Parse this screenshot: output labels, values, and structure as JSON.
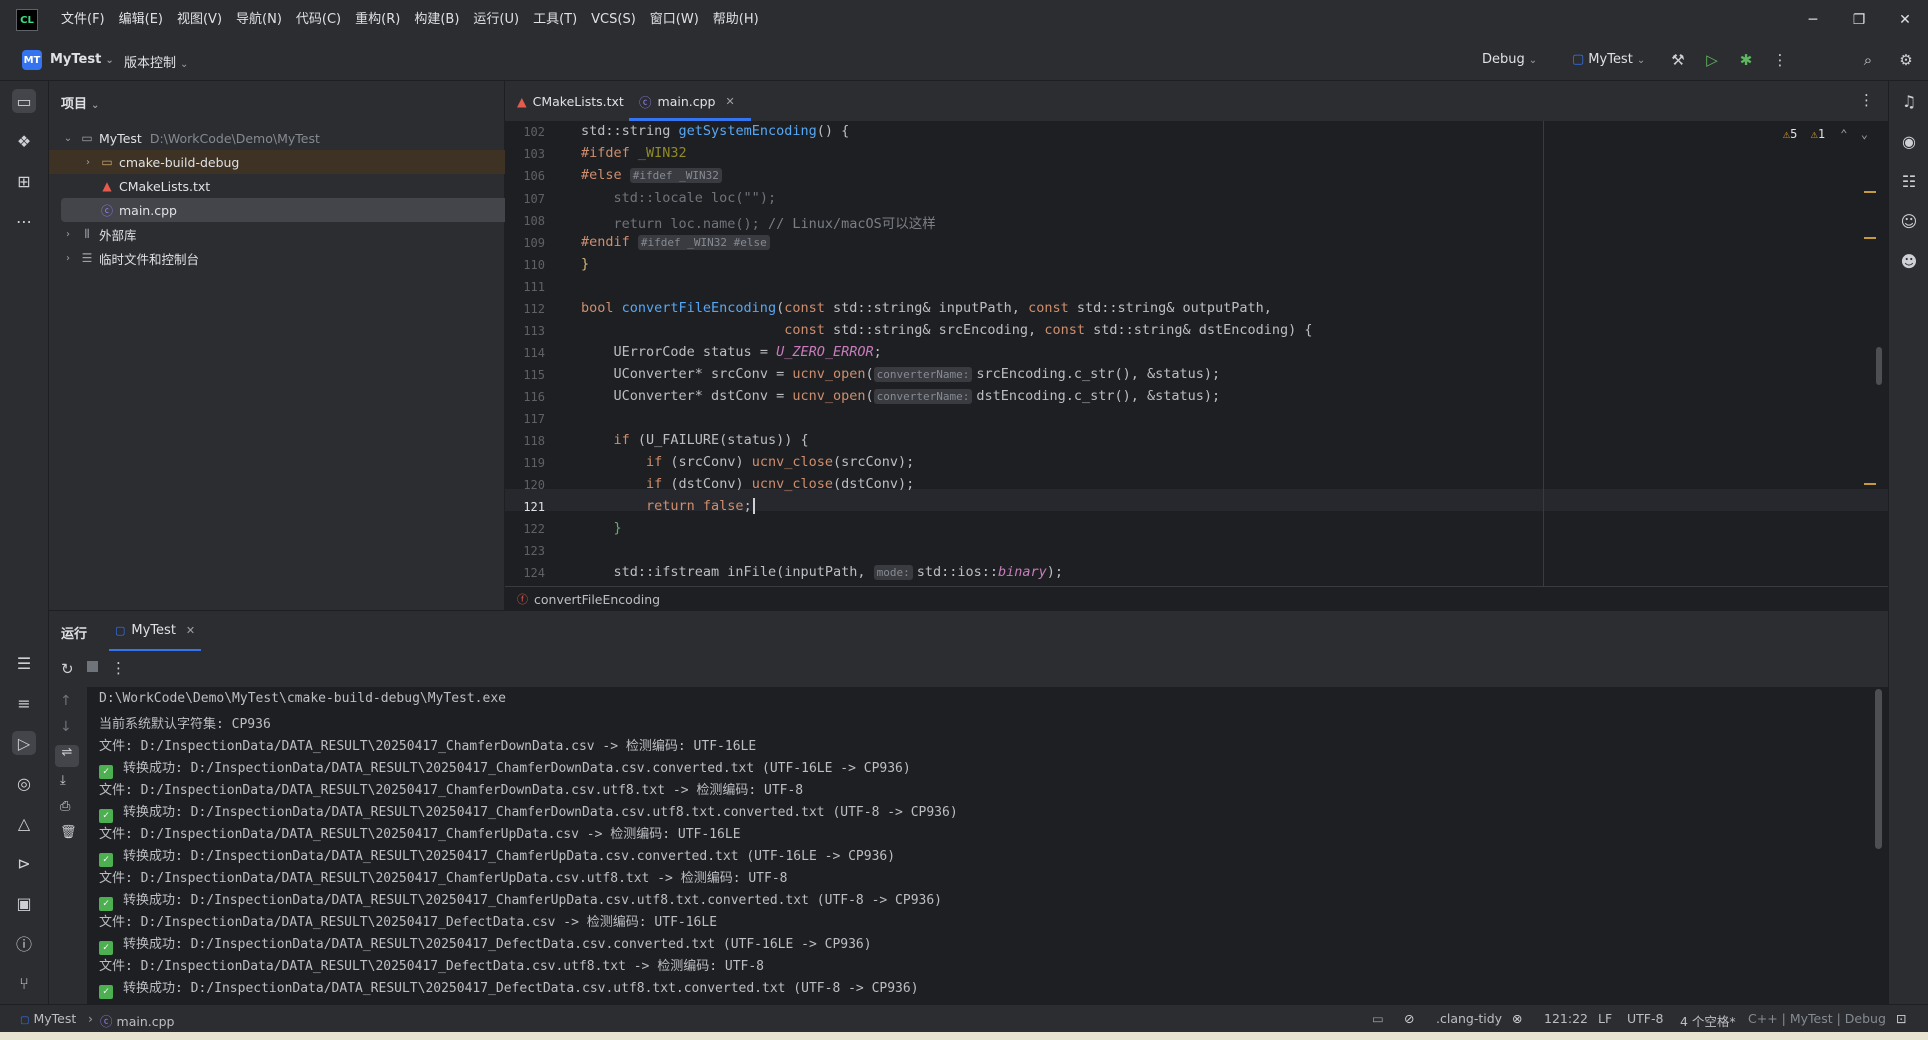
{
  "menubar": {
    "logo": "CL",
    "items": [
      "文件(F)",
      "编辑(E)",
      "视图(V)",
      "导航(N)",
      "代码(C)",
      "重构(R)",
      "构建(B)",
      "运行(U)",
      "工具(T)",
      "VCS(S)",
      "窗口(W)",
      "帮助(H)"
    ]
  },
  "toolbar": {
    "project_badge": "MT",
    "project_name": "MyTest",
    "vcs_label": "版本控制",
    "debug_config": "Debug",
    "run_target": "MyTest"
  },
  "project_panel": {
    "title": "项目",
    "tree": [
      {
        "label": "MyTest",
        "path": "D:\\WorkCode\\Demo\\MyTest"
      },
      {
        "label": "cmake-build-debug"
      },
      {
        "label": "CMakeLists.txt"
      },
      {
        "label": "main.cpp"
      },
      {
        "label": "外部库"
      },
      {
        "label": "临时文件和控制台"
      }
    ]
  },
  "editor": {
    "tabs": [
      {
        "label": "CMakeLists.txt"
      },
      {
        "label": "main.cpp"
      }
    ],
    "inspections": {
      "warnings": "5",
      "weak_warnings": "1"
    },
    "line_numbers": [
      "102",
      "103",
      "106",
      "107",
      "108",
      "109",
      "110",
      "111",
      "112",
      "113",
      "114",
      "115",
      "116",
      "117",
      "118",
      "119",
      "120",
      "121",
      "122",
      "123",
      "124"
    ],
    "code": {
      "l102_type": "std::string ",
      "l102_fn": "getSystemEncoding",
      "l102_rest": "() {",
      "l103_kw": "#ifdef",
      "l103_macro": "_WIN32",
      "l106_kw": "#else",
      "l106_hint": "#ifdef _WIN32",
      "l107": "std::locale loc(\"\");",
      "l108_a": "return loc.name(); ",
      "l108_cmt": "// Linux/macOS可以这样",
      "l109_kw": "#endif",
      "l109_hint": "#ifdef _WIN32 #else",
      "l110": "}",
      "l112_kw": "bool ",
      "l112_fn": "convertFileEncoding",
      "l112_a": "(",
      "l112_b": "const ",
      "l112_c": "std::string& inputPath, ",
      "l112_d": "const ",
      "l112_e": "std::string& outputPath,",
      "l113_a": "const ",
      "l113_b": "std::string& srcEncoding, ",
      "l113_c": "const ",
      "l113_d": "std::string& dstEncoding) {",
      "l114_a": "UErrorCode status = ",
      "l114_const": "U_ZERO_ERROR",
      "l114_b": ";",
      "l115_a": "UConverter* srcConv = ",
      "l115_fn": "ucnv_open",
      "l115_hint": "converterName:",
      "l115_b": "srcEncoding.c_str(), &status);",
      "l116_a": "UConverter* dstConv = ",
      "l116_fn": "ucnv_open",
      "l116_hint": "converterName:",
      "l116_b": "dstEncoding.c_str(), &status);",
      "l118_kw": "if ",
      "l118_a": "(U_FAILURE(status)) {",
      "l119_kw": "if ",
      "l119_a": "(srcConv) ",
      "l119_fn": "ucnv_close",
      "l119_b": "(srcConv);",
      "l120_kw": "if ",
      "l120_a": "(dstConv) ",
      "l120_fn": "ucnv_close",
      "l120_b": "(dstConv);",
      "l121_kw": "return false",
      "l121_b": ";",
      "l122": "}",
      "l124_a": "std::ifstream inFile(inputPath, ",
      "l124_hint": "mode:",
      "l124_b": "std::ios::",
      "l124_c": "binary",
      "l124_d": ");"
    },
    "breadcrumb": "convertFileEncoding"
  },
  "run_panel": {
    "title": "运行",
    "tab_label": "MyTest",
    "console": [
      {
        "ok": false,
        "text": "D:\\WorkCode\\Demo\\MyTest\\cmake-build-debug\\MyTest.exe"
      },
      {
        "ok": false,
        "text": "当前系统默认字符集: CP936"
      },
      {
        "ok": false,
        "text": "文件: D:/InspectionData/DATA_RESULT\\20250417_ChamferDownData.csv -> 检测编码: UTF-16LE"
      },
      {
        "ok": true,
        "text": "转换成功: D:/InspectionData/DATA_RESULT\\20250417_ChamferDownData.csv.converted.txt (UTF-16LE -> CP936)"
      },
      {
        "ok": false,
        "text": "文件: D:/InspectionData/DATA_RESULT\\20250417_ChamferDownData.csv.utf8.txt -> 检测编码: UTF-8"
      },
      {
        "ok": true,
        "text": "转换成功: D:/InspectionData/DATA_RESULT\\20250417_ChamferDownData.csv.utf8.txt.converted.txt (UTF-8 -> CP936)"
      },
      {
        "ok": false,
        "text": "文件: D:/InspectionData/DATA_RESULT\\20250417_ChamferUpData.csv -> 检测编码: UTF-16LE"
      },
      {
        "ok": true,
        "text": "转换成功: D:/InspectionData/DATA_RESULT\\20250417_ChamferUpData.csv.converted.txt (UTF-16LE -> CP936)"
      },
      {
        "ok": false,
        "text": "文件: D:/InspectionData/DATA_RESULT\\20250417_ChamferUpData.csv.utf8.txt -> 检测编码: UTF-8"
      },
      {
        "ok": true,
        "text": "转换成功: D:/InspectionData/DATA_RESULT\\20250417_ChamferUpData.csv.utf8.txt.converted.txt (UTF-8 -> CP936)"
      },
      {
        "ok": false,
        "text": "文件: D:/InspectionData/DATA_RESULT\\20250417_DefectData.csv -> 检测编码: UTF-16LE"
      },
      {
        "ok": true,
        "text": "转换成功: D:/InspectionData/DATA_RESULT\\20250417_DefectData.csv.converted.txt (UTF-16LE -> CP936)"
      },
      {
        "ok": false,
        "text": "文件: D:/InspectionData/DATA_RESULT\\20250417_DefectData.csv.utf8.txt -> 检测编码: UTF-8"
      },
      {
        "ok": true,
        "text": "转换成功: D:/InspectionData/DATA_RESULT\\20250417_DefectData.csv.utf8.txt.converted.txt (UTF-8 -> CP936)"
      }
    ]
  },
  "statusbar": {
    "project": "MyTest",
    "file": "main.cpp",
    "clang_tidy": ".clang-tidy",
    "position": "121:22",
    "line_ending": "LF",
    "encoding": "UTF-8",
    "indent": "4 个空格*",
    "context": "C++ | MyTest | Debug"
  },
  "colors": {
    "accent": "#3574f0",
    "success": "#4caf50",
    "warning": "#e0a030"
  }
}
